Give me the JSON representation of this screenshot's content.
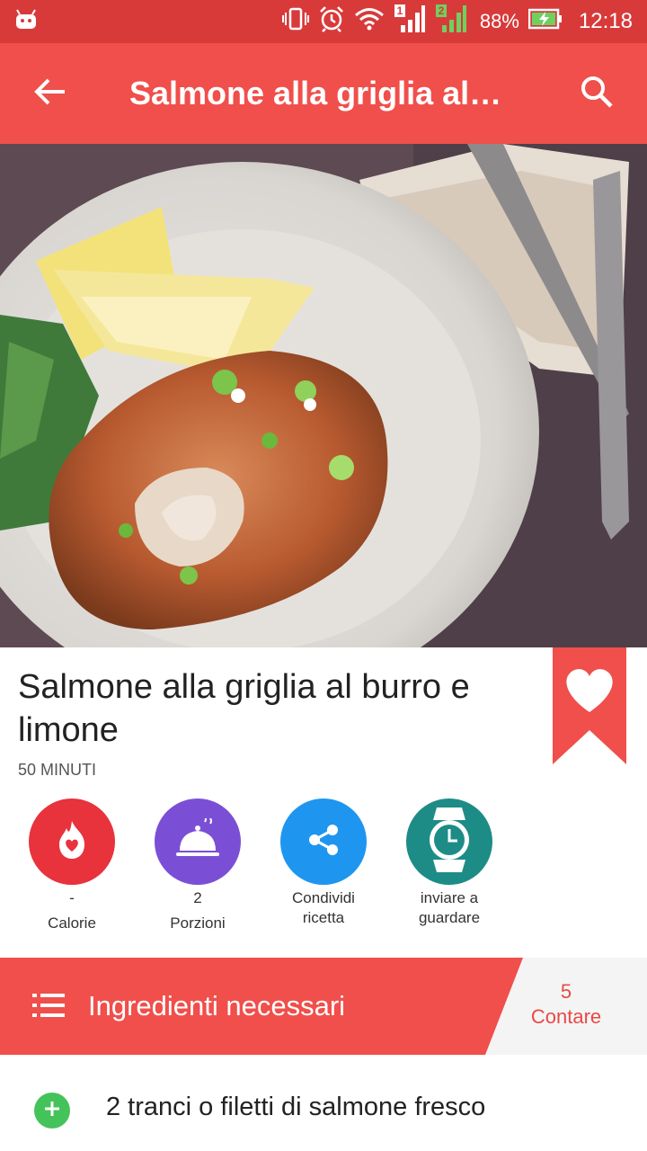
{
  "status_bar": {
    "battery": "88%",
    "time": "12:18",
    "icons": [
      "android-icon",
      "vibrate-icon",
      "alarm-icon",
      "wifi-icon",
      "signal-sim1-icon",
      "signal-sim2-icon",
      "battery-charging-icon"
    ]
  },
  "app_bar": {
    "title": "Salmone alla griglia al…",
    "back_icon": "arrow-back-icon",
    "search_icon": "search-icon"
  },
  "recipe": {
    "title": "Salmone alla griglia al burro e limone",
    "time": "50 MINUTI",
    "bookmark_icon": "heart-icon"
  },
  "actions": [
    {
      "value": "-",
      "label": "Calorie",
      "icon": "flame-heart-icon",
      "color": "#e8323c"
    },
    {
      "value": "2",
      "label": "Porzioni",
      "icon": "cloche-icon",
      "color": "#7a4fd6"
    },
    {
      "line1": "Condividi",
      "line2": "ricetta",
      "icon": "share-icon",
      "color": "#1e96f0"
    },
    {
      "line1": "inviare a",
      "line2": "guardare",
      "icon": "watch-icon",
      "color": "#1e8c86"
    }
  ],
  "ingredients": {
    "header": "Ingredienti necessari",
    "count_value": "5",
    "count_label": "Contare",
    "items": [
      {
        "text": "2 tranci o filetti di salmone fresco"
      }
    ]
  },
  "colors": {
    "status_bar": "#d83a3a",
    "app_bar": "#f04f4b",
    "accent": "#f04f4b",
    "add_button": "#44c35a"
  }
}
